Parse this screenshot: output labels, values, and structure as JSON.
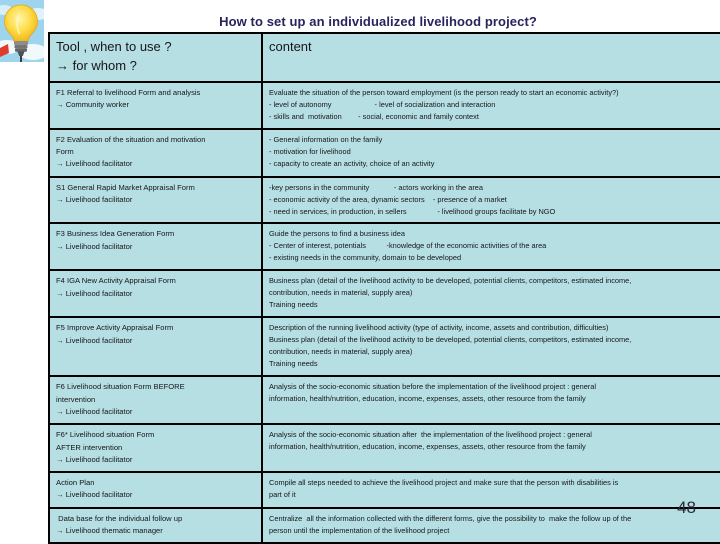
{
  "slide": {
    "title": "How to set up an individualized livelihood project?",
    "page_number": "48",
    "title_color": "#27245c",
    "table_fill_color": "#b6dfe3",
    "table_border_color": "#000000"
  },
  "logo": {
    "name": "lightbulb-icon",
    "sky_color": "#9fd4ef",
    "bulb_color": "#ffd83b",
    "base_color": "#6b6b6b"
  },
  "table": {
    "headers": {
      "tool": [
        "Tool , when to use ?",
        "→ for whom ?"
      ],
      "content": "content"
    },
    "rows": [
      {
        "tool": [
          "F1 Referral to livelihood Form and analysis",
          "→ Community worker"
        ],
        "content": [
          "Evaluate the situation of the person toward employment (is the person ready to start an economic activity?)",
          "- level of autonomy                     - level of socialization and interaction",
          "- skills and  motivation        - social, economic and family context"
        ]
      },
      {
        "tool": [
          "F2 Evaluation of the situation and motivation",
          "Form",
          "→ Livelihood facilitator"
        ],
        "content": [
          "- General information on the family",
          "- motivation for livelihood",
          "- capacity to create an activity, choice of an activity"
        ]
      },
      {
        "tool": [
          "S1 General Rapid Market Appraisal Form",
          "→ Livelihood facilitator"
        ],
        "content": [
          "-key persons in the community            - actors working in the area",
          "- economic activity of the area, dynamic sectors    - presence of a market",
          "- need in services, in production, in sellers               - livelihood groups facilitate by NGO"
        ]
      },
      {
        "tool": [
          "F3 Business Idea Generation Form",
          "→ Livelihood facilitator"
        ],
        "content": [
          "Guide the persons to find a business idea",
          "- Center of interest, potentials          -knowledge of the economic activities of the area",
          "- existing needs in the community, domain to be developed"
        ]
      },
      {
        "tool": [
          "F4 IGA New Activity Appraisal Form",
          "→ Livelihood facilitator"
        ],
        "content": [
          "Business plan (detail of the livelihood activity to be developed, potential clients, competitors, estimated income,",
          "contribution, needs in material, supply area)",
          "Training needs"
        ]
      },
      {
        "tool": [
          "F5 Improve Activity Appraisal Form",
          "→ Livelihood facilitator"
        ],
        "content": [
          "Description of the running livelihood activity (type of activity, income, assets and contribution, difficulties)",
          "Business plan (detail of the livelihood activity to be developed, potential clients, competitors, estimated income,",
          "contribution, needs in material, supply area)",
          "Training needs"
        ]
      },
      {
        "tool": [
          "F6 Livelihood situation Form BEFORE",
          "intervention",
          "→ Livelihood facilitator"
        ],
        "content": [
          "Analysis of the socio-economic situation before the implementation of the livelihood project : general",
          "information, health/nutrition, education, income, expenses, assets, other resource from the family"
        ]
      },
      {
        "tool": [
          "F6* Livelihood situation Form",
          "AFTER intervention",
          "→ Livelihood facilitator"
        ],
        "content": [
          "Analysis of the socio-economic situation after  the implementation of the livelihood project : general",
          "information, health/nutrition, education, income, expenses, assets, other resource from the family"
        ]
      },
      {
        "tool": [
          "Action Plan",
          "→ Livelihood facilitator"
        ],
        "content": [
          "Compile all steps needed to achieve the livelihood project and make sure that the person with disabilities is",
          "part of it"
        ]
      },
      {
        "tool": [
          " Data base for the individual follow up",
          "→ Livelihood thematic manager"
        ],
        "content": [
          "Centralize  all the information collected with the different forms, give the possibility to  make the follow up of the",
          "person until the implementation of the livelihood project"
        ]
      }
    ]
  }
}
